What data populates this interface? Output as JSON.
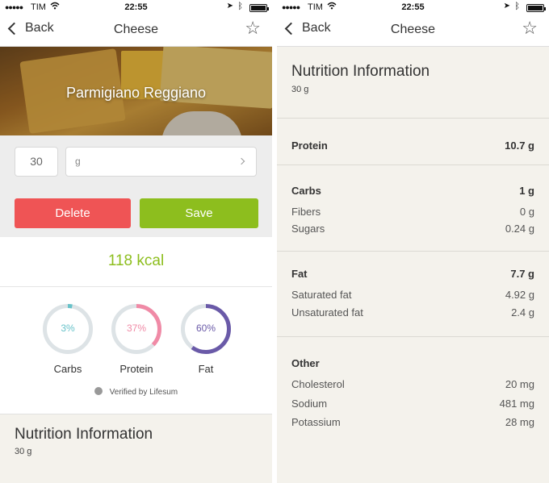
{
  "status": {
    "carrier": "TIM",
    "time": "22:55"
  },
  "nav": {
    "back_label": "Back",
    "title": "Cheese"
  },
  "food": {
    "name": "Parmigiano Reggiano"
  },
  "serving": {
    "quantity": "30",
    "unit": "g"
  },
  "buttons": {
    "delete": "Delete",
    "save": "Save"
  },
  "energy": {
    "kcal": "118 kcal"
  },
  "macros": [
    {
      "label": "Carbs",
      "pct": "3%",
      "value": 0.03,
      "color": "#67c2c9"
    },
    {
      "label": "Protein",
      "pct": "37%",
      "value": 0.37,
      "color": "#f08aa6"
    },
    {
      "label": "Fat",
      "pct": "60%",
      "value": 0.6,
      "color": "#6a5aa8"
    }
  ],
  "verified": "Verified by Lifesum",
  "nutrition": {
    "title": "Nutrition Information",
    "serving": "30  g",
    "protein": {
      "label": "Protein",
      "value": "10.7 g"
    },
    "carbs": {
      "label": "Carbs",
      "value": "1 g"
    },
    "fibers": {
      "label": "Fibers",
      "value": "0 g"
    },
    "sugars": {
      "label": "Sugars",
      "value": "0.24 g"
    },
    "fat": {
      "label": "Fat",
      "value": "7.7 g"
    },
    "saturated": {
      "label": "Saturated fat",
      "value": "4.92 g"
    },
    "unsaturated": {
      "label": "Unsaturated fat",
      "value": "2.4 g"
    },
    "other": {
      "label": "Other"
    },
    "cholesterol": {
      "label": "Cholesterol",
      "value": "20 mg"
    },
    "sodium": {
      "label": "Sodium",
      "value": "481 mg"
    },
    "potassium": {
      "label": "Potassium",
      "value": "28 mg"
    }
  }
}
